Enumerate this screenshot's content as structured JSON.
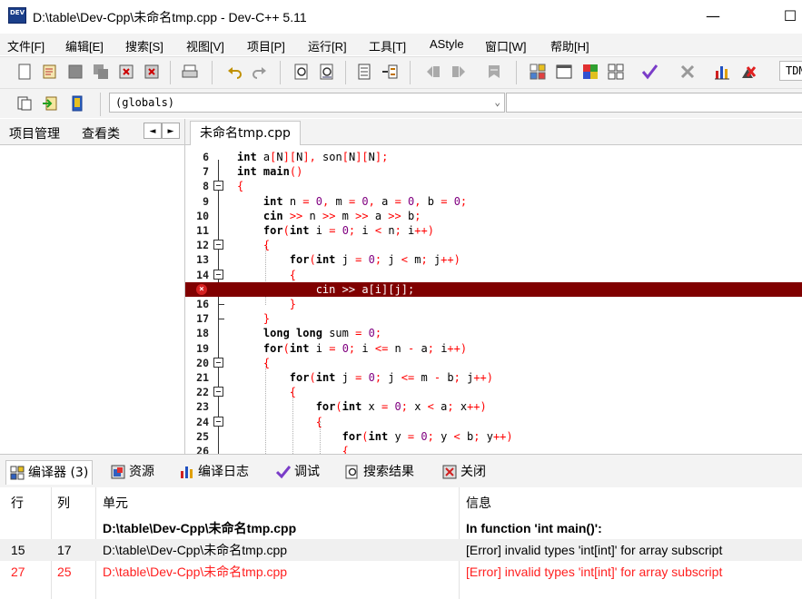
{
  "window": {
    "title": "D:\\table\\Dev-Cpp\\未命名tmp.cpp - Dev-C++ 5.11",
    "icon_text": "DEV",
    "minimize": "—",
    "maximize": "☐"
  },
  "menu": [
    "文件[F]",
    "编辑[E]",
    "搜索[S]",
    "视图[V]",
    "项目[P]",
    "运行[R]",
    "工具[T]",
    "AStyle",
    "窗口[W]",
    "帮助[H]"
  ],
  "toolbar": {
    "icons": [
      "new-file-icon",
      "open-project-icon",
      "save-icon",
      "save-all-icon",
      "close-icon",
      "close-all-icon",
      "print-icon",
      "undo-icon",
      "redo-icon",
      "find-icon",
      "replace-icon",
      "indent-icon",
      "unindent-icon",
      "bookmark-prev-icon",
      "bookmark-next-icon",
      "bookmark-icon",
      "compile-icon",
      "run-icon",
      "compile-run-icon",
      "rebuild-icon",
      "check-icon",
      "stop-icon",
      "chart-icon",
      "debug-icon"
    ],
    "compiler_select": "TDM"
  },
  "toolbar2": {
    "globals_value": "(globals)"
  },
  "left_panel": {
    "tabs": [
      "项目管理",
      "查看类"
    ],
    "nav_prev": "◄",
    "nav_next": "►"
  },
  "editor": {
    "tab_label": "未命名tmp.cpp",
    "lines": [
      {
        "n": "6",
        "text": "int a[N][N], son[N][N];"
      },
      {
        "n": "7",
        "text": "int main()"
      },
      {
        "n": "8",
        "text": "{"
      },
      {
        "n": "9",
        "text": "    int n = 0, m = 0, a = 0, b = 0;"
      },
      {
        "n": "10",
        "text": "    cin >> n >> m >> a >> b;"
      },
      {
        "n": "11",
        "text": "    for(int i = 0; i < n; i++)"
      },
      {
        "n": "12",
        "text": "    {"
      },
      {
        "n": "13",
        "text": "        for(int j = 0; j < m; j++)"
      },
      {
        "n": "14",
        "text": "        {"
      },
      {
        "n": "15",
        "text": "            cin >> a[i][j];"
      },
      {
        "n": "16",
        "text": "        }"
      },
      {
        "n": "17",
        "text": "    }"
      },
      {
        "n": "18",
        "text": "    long long sum = 0;"
      },
      {
        "n": "19",
        "text": "    for(int i = 0; i <= n - a; i++)"
      },
      {
        "n": "20",
        "text": "    {"
      },
      {
        "n": "21",
        "text": "        for(int j = 0; j <= m - b; j++)"
      },
      {
        "n": "22",
        "text": "        {"
      },
      {
        "n": "23",
        "text": "            for(int x = 0; x < a; x++)"
      },
      {
        "n": "24",
        "text": "            {"
      },
      {
        "n": "25",
        "text": "                for(int y = 0; y < b; y++)"
      },
      {
        "n": "26",
        "text": "                {"
      }
    ],
    "error_line": "15"
  },
  "bottom_tabs": [
    {
      "label": "编译器 (3)",
      "icon": "compiler-grid-icon"
    },
    {
      "label": "资源",
      "icon": "resources-icon"
    },
    {
      "label": "编译日志",
      "icon": "compile-log-icon"
    },
    {
      "label": "调试",
      "icon": "debug-check-icon"
    },
    {
      "label": "搜索结果",
      "icon": "search-results-icon"
    },
    {
      "label": "关闭",
      "icon": "close-panel-icon"
    }
  ],
  "results": {
    "headers": {
      "line": "行",
      "col": "列",
      "unit": "单元",
      "message": "信息"
    },
    "rows": [
      {
        "line": "",
        "col": "",
        "unit": "D:\\table\\Dev-Cpp\\未命名tmp.cpp",
        "message": "In function 'int main()':",
        "style": "bold"
      },
      {
        "line": "15",
        "col": "17",
        "unit": "D:\\table\\Dev-Cpp\\未命名tmp.cpp",
        "message": "[Error] invalid types 'int[int]' for array subscript",
        "style": "selected"
      },
      {
        "line": "27",
        "col": "25",
        "unit": "D:\\table\\Dev-Cpp\\未命名tmp.cpp",
        "message": "[Error] invalid types 'int[int]' for array subscript",
        "style": "error"
      }
    ]
  },
  "colors": {
    "error_line_bg": "#800000",
    "error_text": "#ff2020",
    "selected_row_bg": "#f0f0f0",
    "operator": "#ff0000",
    "number": "#800080"
  }
}
